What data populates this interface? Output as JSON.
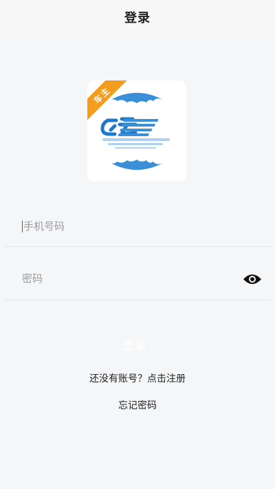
{
  "header": {
    "title": "登录"
  },
  "logo": {
    "badge": "车主",
    "icon": "truck-cloud-app-logo-icon"
  },
  "form": {
    "phone_placeholder": "手机号码",
    "password_placeholder": "密码",
    "password_toggle_icon": "eye-icon"
  },
  "actions": {
    "login_label": "登录",
    "login_arrow": "›",
    "register_link": "还没有账号？点击注册",
    "forgot_link": "忘记密码"
  },
  "colors": {
    "badge": "#f39c1e",
    "logo_blue": "#3a8fd6",
    "background": "#f5f6f8"
  }
}
